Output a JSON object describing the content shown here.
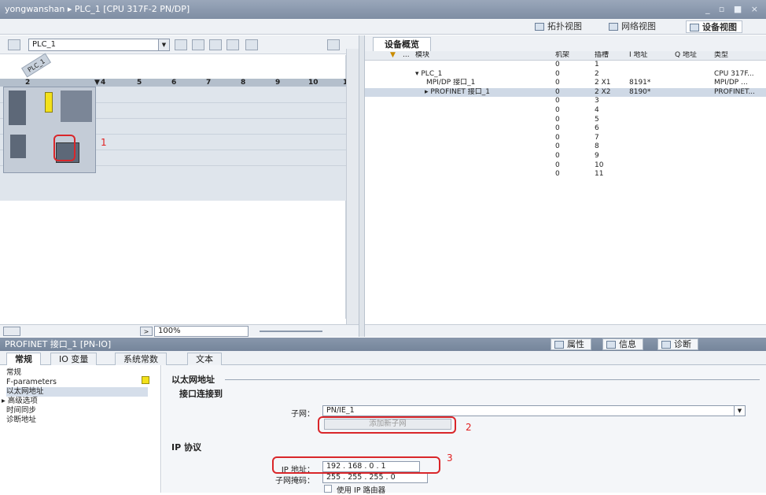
{
  "titlebar": {
    "title": "yongwanshan ▸ PLC_1 [CPU 317F-2 PN/DP]",
    "window_controls": "_ ▫ ■ ×"
  },
  "viewbar": {
    "topology": "拓扑视图",
    "network": "网络视图",
    "device": "设备视图"
  },
  "device_pane": {
    "device_select": "PLC_1",
    "station_label": "PLC_1",
    "rack_slots": [
      "2",
      "4",
      "5",
      "6",
      "7",
      "8",
      "9",
      "10",
      "1"
    ],
    "zoom": "100%"
  },
  "overview": {
    "tab": "设备概览",
    "columns": [
      "模块",
      "机架",
      "插槽",
      "I 地址",
      "Q 地址",
      "类型"
    ],
    "rows": [
      {
        "module": "",
        "rack": "0",
        "slot": "1",
        "i_addr": "",
        "q_addr": "",
        "type": ""
      },
      {
        "module": "▾ PLC_1",
        "rack": "0",
        "slot": "2",
        "i_addr": "",
        "q_addr": "",
        "type": "CPU 317F..."
      },
      {
        "module": "MPI/DP 接口_1",
        "rack": "0",
        "slot": "2 X1",
        "i_addr": "8191*",
        "q_addr": "",
        "type": "MPI/DP ..."
      },
      {
        "module": "▸ PROFINET 接口_1",
        "rack": "0",
        "slot": "2 X2",
        "i_addr": "8190*",
        "q_addr": "",
        "type": "PROFINET..."
      },
      {
        "module": "",
        "rack": "0",
        "slot": "3",
        "i_addr": "",
        "q_addr": "",
        "type": ""
      },
      {
        "module": "",
        "rack": "0",
        "slot": "4",
        "i_addr": "",
        "q_addr": "",
        "type": ""
      },
      {
        "module": "",
        "rack": "0",
        "slot": "5",
        "i_addr": "",
        "q_addr": "",
        "type": ""
      },
      {
        "module": "",
        "rack": "0",
        "slot": "6",
        "i_addr": "",
        "q_addr": "",
        "type": ""
      },
      {
        "module": "",
        "rack": "0",
        "slot": "7",
        "i_addr": "",
        "q_addr": "",
        "type": ""
      },
      {
        "module": "",
        "rack": "0",
        "slot": "8",
        "i_addr": "",
        "q_addr": "",
        "type": ""
      },
      {
        "module": "",
        "rack": "0",
        "slot": "9",
        "i_addr": "",
        "q_addr": "",
        "type": ""
      },
      {
        "module": "",
        "rack": "0",
        "slot": "10",
        "i_addr": "",
        "q_addr": "",
        "type": ""
      },
      {
        "module": "",
        "rack": "0",
        "slot": "11",
        "i_addr": "",
        "q_addr": "",
        "type": ""
      }
    ]
  },
  "properties": {
    "title": "PROFINET 接口_1 [PN-IO]",
    "tabs": {
      "props": "属性",
      "info": "信息",
      "diag": "诊断"
    },
    "subtabs": [
      "常规",
      "IO 变量",
      "系统常数",
      "文本"
    ],
    "nav": [
      "常规",
      "F-parameters",
      "以太网地址",
      "▸ 高级选项",
      "时间同步",
      "诊断地址"
    ],
    "ethernet_title": "以太网地址",
    "interface_section": "接口连接到",
    "subnet_label": "子网：",
    "subnet_value": "PN/IE_1",
    "add_subnet": "添加新子网",
    "ip_section": "IP 协议",
    "ip_label": "IP 地址：",
    "ip_value": "192 . 168 . 0 . 1",
    "mask_label": "子网掩码：",
    "mask_value": "255 . 255 . 255 . 0",
    "router_label": "使用 IP 路由器"
  },
  "annotations": [
    "1",
    "2",
    "3"
  ],
  "colors": {
    "title_bar": "#8897ab",
    "highlight_box": "#d9262a",
    "selected_row": "#cfd9e6"
  }
}
